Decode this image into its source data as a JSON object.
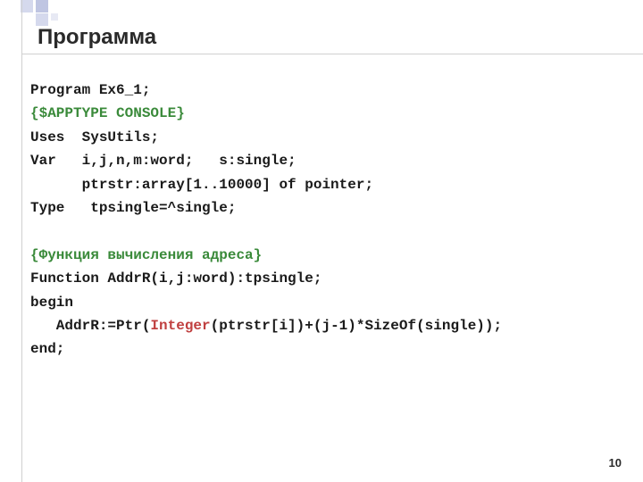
{
  "title": "Программа",
  "code": {
    "l1": "Program Ex6_1;",
    "l2": "{$APPTYPE CONSOLE}",
    "l3": "Uses  SysUtils;",
    "l4": "Var   i,j,n,m:word;   s:single;",
    "l5": "      ptrstr:array[1..10000] of pointer;",
    "l6": "Type   tpsingle=^single;",
    "l7": " ",
    "l8": "{Функция вычисления адреса}",
    "l9": "Function AddrR(i,j:word):tpsingle;",
    "l10": "begin",
    "l11_a": "   AddrR:=Ptr(",
    "l11_b": "Integer",
    "l11_c": "(ptrstr[i])+(j-1)*SizeOf(single));",
    "l12": "end;"
  },
  "page_number": "10"
}
